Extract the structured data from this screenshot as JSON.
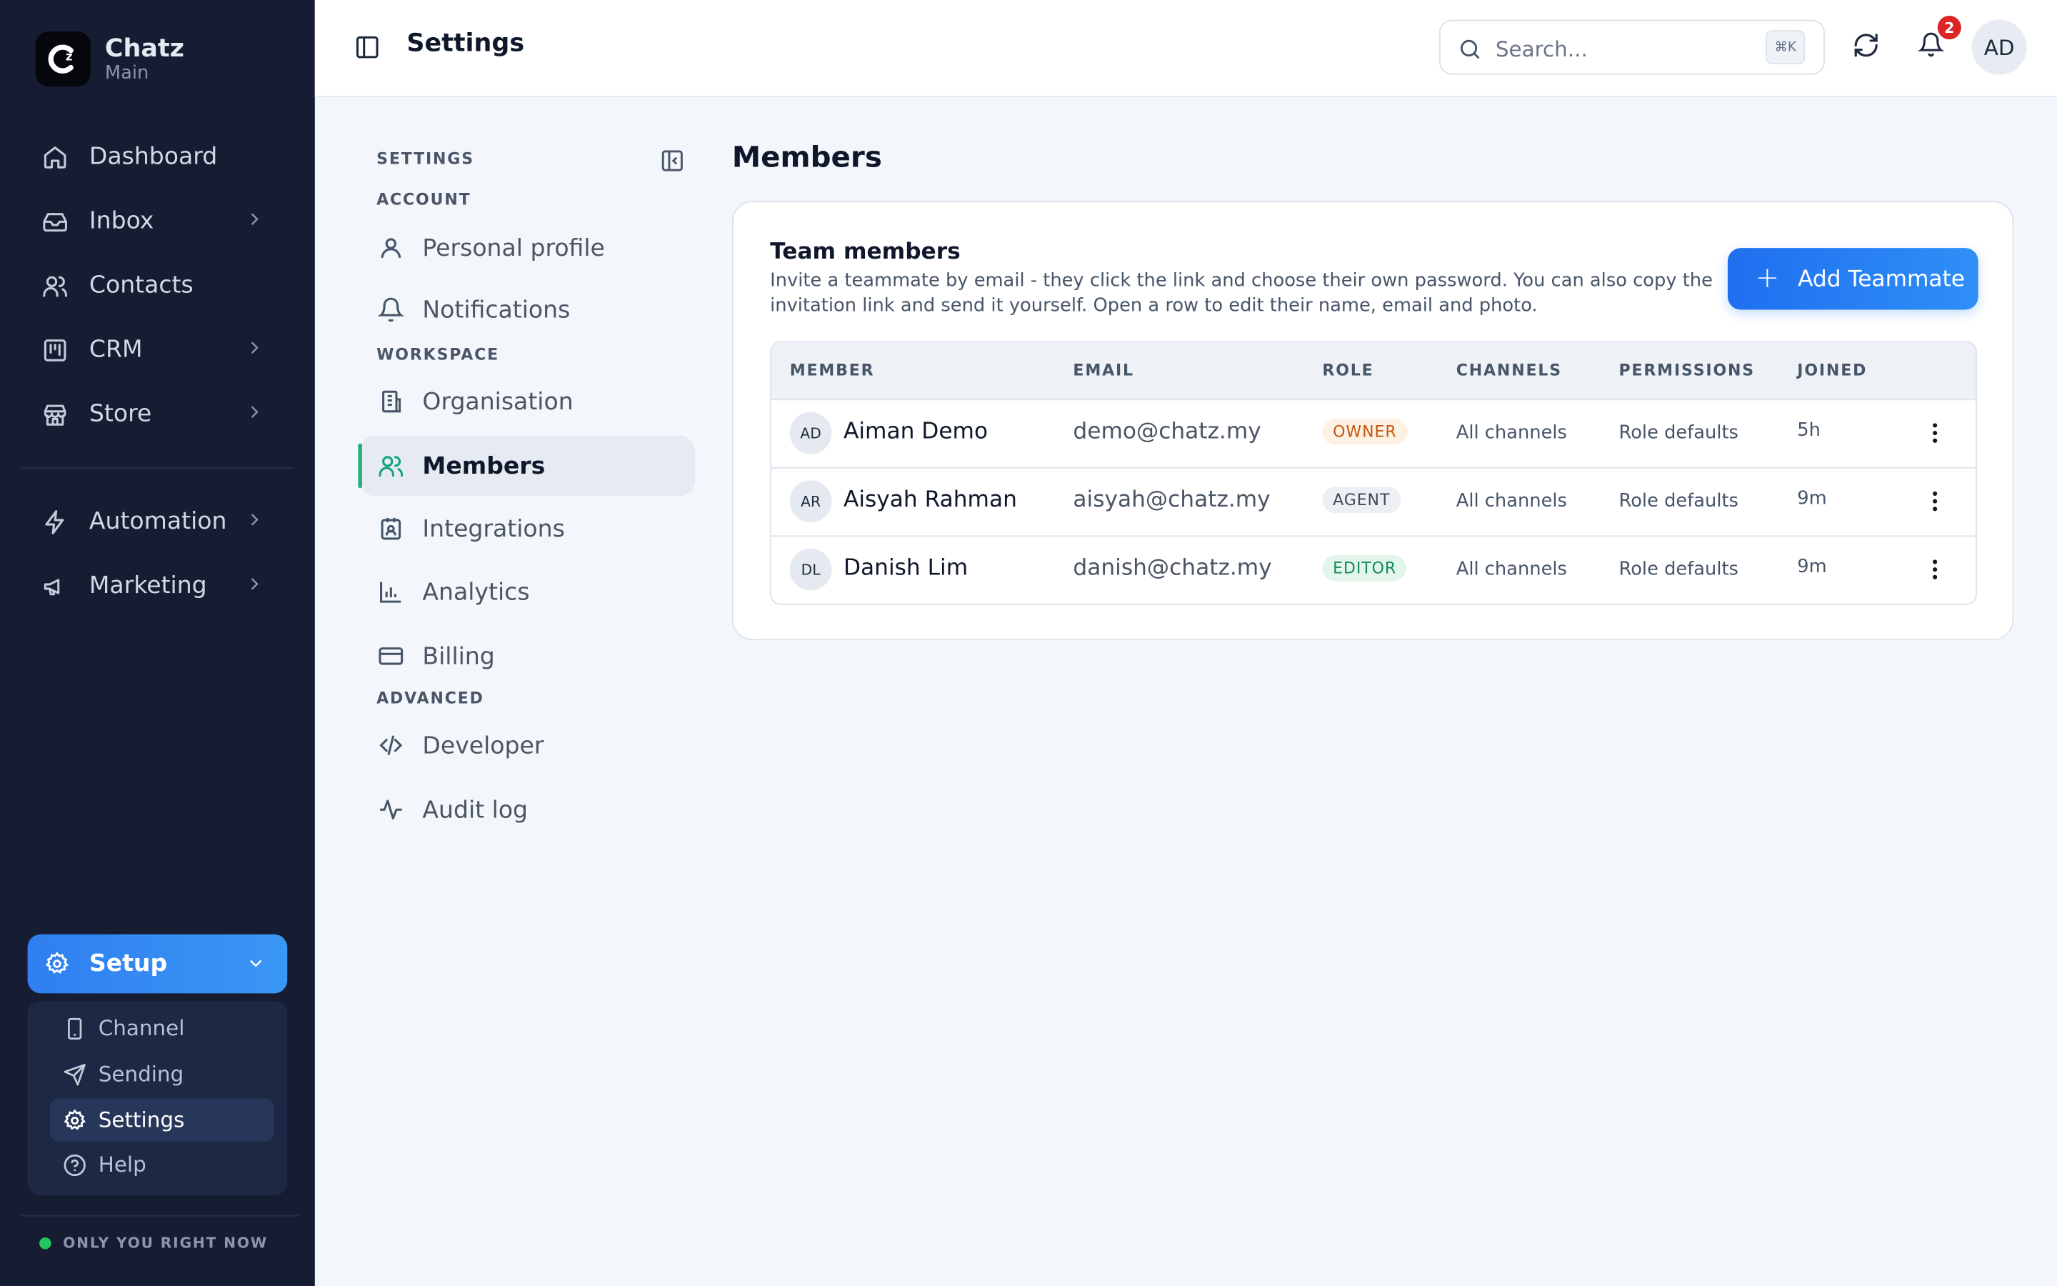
{
  "brand": {
    "name": "Chatz",
    "subtitle": "Main"
  },
  "sidebar": {
    "items": [
      {
        "label": "Dashboard",
        "icon": "home-icon",
        "has_chevron": false
      },
      {
        "label": "Inbox",
        "icon": "inbox-icon",
        "has_chevron": true
      },
      {
        "label": "Contacts",
        "icon": "users-icon",
        "has_chevron": false
      },
      {
        "label": "CRM",
        "icon": "kanban-icon",
        "has_chevron": true
      },
      {
        "label": "Store",
        "icon": "store-icon",
        "has_chevron": true
      },
      {
        "label": "Automation",
        "icon": "bolt-icon",
        "has_chevron": true
      },
      {
        "label": "Marketing",
        "icon": "megaphone-icon",
        "has_chevron": true
      }
    ],
    "setup": {
      "label": "Setup",
      "submenu": [
        {
          "label": "Channel",
          "icon": "phone-icon",
          "active": false
        },
        {
          "label": "Sending",
          "icon": "send-icon",
          "active": false
        },
        {
          "label": "Settings",
          "icon": "gear-icon",
          "active": true
        },
        {
          "label": "Help",
          "icon": "help-circle-icon",
          "active": false
        }
      ]
    },
    "presence": "ONLY YOU RIGHT NOW"
  },
  "topbar": {
    "title": "Settings",
    "search_placeholder": "Search...",
    "search_shortcut": "⌘K",
    "notification_count": "2",
    "user_initials": "AD"
  },
  "settings_nav": {
    "header": "SETTINGS",
    "sections": [
      {
        "label": "ACCOUNT"
      },
      {
        "label": "WORKSPACE"
      },
      {
        "label": "ADVANCED"
      }
    ],
    "items": [
      {
        "label": "Personal profile",
        "icon": "user-icon",
        "active": false
      },
      {
        "label": "Notifications",
        "icon": "bell-icon",
        "active": false
      },
      {
        "label": "Organisation",
        "icon": "building-icon",
        "active": false
      },
      {
        "label": "Members",
        "icon": "users-icon",
        "active": true
      },
      {
        "label": "Integrations",
        "icon": "plug-icon",
        "active": false
      },
      {
        "label": "Analytics",
        "icon": "bar-chart-icon",
        "active": false
      },
      {
        "label": "Billing",
        "icon": "credit-card-icon",
        "active": false
      },
      {
        "label": "Developer",
        "icon": "code-icon",
        "active": false
      },
      {
        "label": "Audit log",
        "icon": "activity-icon",
        "active": false
      }
    ]
  },
  "main": {
    "title": "Members",
    "card": {
      "title": "Team members",
      "description": "Invite a teammate by email - they click the link and choose their own password. You can also copy the invitation link and send it yourself. Open a row to edit their name, email and photo.",
      "add_button": "Add Teammate"
    },
    "table": {
      "headers": [
        "MEMBER",
        "EMAIL",
        "ROLE",
        "CHANNELS",
        "PERMISSIONS",
        "JOINED"
      ],
      "rows": [
        {
          "initials": "AD",
          "name": "Aiman Demo",
          "email": "demo@chatz.my",
          "role": "OWNER",
          "role_color": "#c2570c",
          "role_bg": "#fdf1e3",
          "channels": "All channels",
          "permissions": "Role defaults",
          "joined": "5h"
        },
        {
          "initials": "AR",
          "name": "Aisyah Rahman",
          "email": "aisyah@chatz.my",
          "role": "AGENT",
          "role_color": "#3f4a5c",
          "role_bg": "#eceff4",
          "channels": "All channels",
          "permissions": "Role defaults",
          "joined": "9m"
        },
        {
          "initials": "DL",
          "name": "Danish Lim",
          "email": "danish@chatz.my",
          "role": "EDITOR",
          "role_color": "#15895a",
          "role_bg": "#e2f6ec",
          "channels": "All channels",
          "permissions": "Role defaults",
          "joined": "9m"
        }
      ]
    }
  }
}
